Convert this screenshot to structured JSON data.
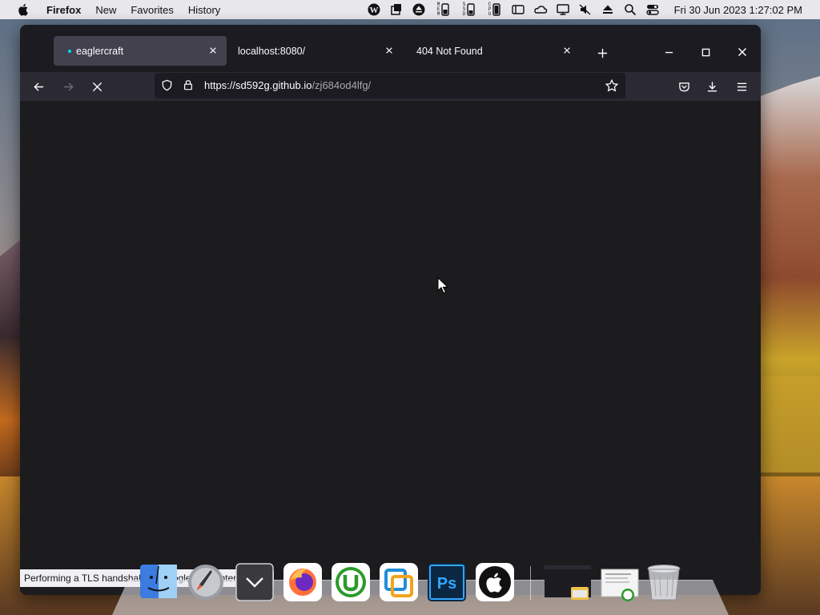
{
  "menubar": {
    "apple_icon": "apple-logo-icon",
    "items": [
      {
        "label": "Firefox",
        "bold": true
      },
      {
        "label": "New"
      },
      {
        "label": "Favorites"
      },
      {
        "label": "History"
      }
    ],
    "status_icons": [
      "wordpress-icon",
      "stacks-icon",
      "eject-circle-icon",
      "mem-icon",
      "ssd-icon",
      "cpu-icon",
      "battery-icon",
      "sidebar-icon",
      "cloud-icon",
      "display-icon",
      "mute-icon",
      "eject-icon",
      "search-icon",
      "control-center-icon"
    ],
    "mem_text": "MEM",
    "ssd_text": "SSD",
    "cpu_text": "CPU",
    "clock": "Fri 30 Jun 2023  1:27:02 PM"
  },
  "browser": {
    "tabs": [
      {
        "title": "eaglercraft",
        "active": true,
        "loading": true
      },
      {
        "title": "localhost:8080/",
        "active": false
      },
      {
        "title": "404 Not Found",
        "active": false
      }
    ],
    "url_host": "https://sd592g.github.io",
    "url_path": "/zj684od4lfg/",
    "status_text": "Performing a TLS handshake to googleusercontent.com..."
  },
  "dock": {
    "apps": [
      "finder-icon",
      "launchpad-icon",
      "downloads-stack-icon",
      "firefox-icon",
      "utorrent-icon",
      "vmware-icon",
      "photoshop-icon",
      "apple-app-icon"
    ],
    "photoshop_text": "Ps",
    "minimized": [
      "browser-window-thumbnail",
      "utorrent-window-thumbnail"
    ],
    "trash": "trash-icon"
  },
  "colors": {
    "window_bg": "#1c1b22",
    "toolbar_bg": "#2b2a33",
    "active_tab": "#42414d",
    "accent": "#00ddff"
  }
}
